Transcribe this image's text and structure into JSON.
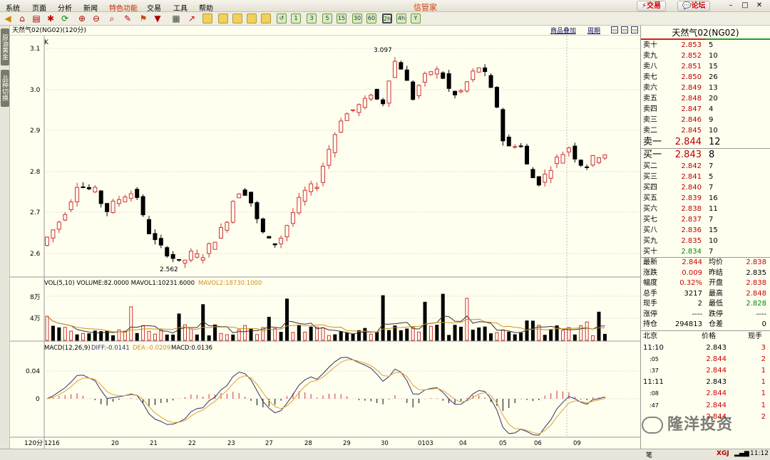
{
  "menu": {
    "items": [
      "系统",
      "页面",
      "分析",
      "新闻",
      "特色功能",
      "交易",
      "工具",
      "帮助"
    ],
    "title": "信管家",
    "trade_btn": "交易",
    "forum_btn": "论坛"
  },
  "toolbar": {
    "buttons": [
      "↺",
      "↻",
      "1",
      "3",
      "5",
      "15",
      "30",
      "60",
      "2h",
      "4h",
      "Y"
    ]
  },
  "left_tabs": [
    "原油黄金",
    "品种切换"
  ],
  "header": {
    "symbol": "天然气02(NG02)(120分)",
    "link_overlay": "商品叠加",
    "link_period": "周期"
  },
  "price_axis": {
    "ticks": [
      "3.1",
      "3.0",
      "2.9",
      "2.8",
      "2.7",
      "2.6"
    ],
    "k_label": "K",
    "high_label": "3.097",
    "low_label": "2.562"
  },
  "volume": {
    "legend": "VOL(5,10) VOLUME:82.0000 MAVOL1:10231.6000",
    "mavol2": "MAVOL2:18730.1000",
    "ticks": [
      "8万",
      "4万"
    ]
  },
  "macd": {
    "legend": "MACD(12,26,9)",
    "diff": "DIFF:-0.0141",
    "dea": "DEA:-0.0209",
    "macd": "MACD:0.0136",
    "ticks": [
      "0.04",
      "0"
    ]
  },
  "xaxis": {
    "period": "120分",
    "labels": [
      "1216",
      "20",
      "21",
      "22",
      "23",
      "27",
      "28",
      "29",
      "30",
      "0103",
      "04",
      "05",
      "06",
      "09"
    ]
  },
  "colors": {
    "up": "#d03030",
    "down": "#000000",
    "mavol1": "#333333",
    "mavol2": "#d09020",
    "diff": "#333366",
    "dea": "#e0a030"
  },
  "right_panel": {
    "title": "天然气02(NG02)",
    "asks": [
      {
        "l": "卖十",
        "p": "2.853",
        "v": "5"
      },
      {
        "l": "卖九",
        "p": "2.852",
        "v": "10"
      },
      {
        "l": "卖八",
        "p": "2.851",
        "v": "15"
      },
      {
        "l": "卖七",
        "p": "2.850",
        "v": "26"
      },
      {
        "l": "卖六",
        "p": "2.849",
        "v": "13"
      },
      {
        "l": "卖五",
        "p": "2.848",
        "v": "20"
      },
      {
        "l": "卖四",
        "p": "2.847",
        "v": "4"
      },
      {
        "l": "卖三",
        "p": "2.846",
        "v": "9"
      },
      {
        "l": "卖二",
        "p": "2.845",
        "v": "10"
      },
      {
        "l": "卖一",
        "p": "2.844",
        "v": "12"
      }
    ],
    "bids": [
      {
        "l": "买一",
        "p": "2.843",
        "v": "8"
      },
      {
        "l": "买二",
        "p": "2.842",
        "v": "7"
      },
      {
        "l": "买三",
        "p": "2.841",
        "v": "5"
      },
      {
        "l": "买四",
        "p": "2.840",
        "v": "7"
      },
      {
        "l": "买五",
        "p": "2.839",
        "v": "16"
      },
      {
        "l": "买六",
        "p": "2.838",
        "v": "11"
      },
      {
        "l": "买七",
        "p": "2.837",
        "v": "7"
      },
      {
        "l": "买八",
        "p": "2.836",
        "v": "15"
      },
      {
        "l": "买九",
        "p": "2.835",
        "v": "10"
      },
      {
        "l": "买十",
        "p": "2.834",
        "v": "7"
      }
    ],
    "stats": [
      {
        "l1": "最新",
        "v1": "2.844",
        "l2": "均价",
        "v2": "2.838"
      },
      {
        "l1": "涨跌",
        "v1": "0.009",
        "l2": "昨结",
        "v2": "2.835"
      },
      {
        "l1": "幅度",
        "v1": "0.32%",
        "l2": "开盘",
        "v2": "2.838"
      },
      {
        "l1": "总手",
        "v1": "3217",
        "l2": "最高",
        "v2": "2.848"
      },
      {
        "l1": "现手",
        "v1": "2",
        "l2": "最低",
        "v2": "2.828"
      },
      {
        "l1": "涨停",
        "v1": "----",
        "l2": "跌停",
        "v2": "----"
      },
      {
        "l1": "持仓",
        "v1": "294813",
        "l2": "仓差",
        "v2": "0"
      }
    ],
    "ticks_header": {
      "c1": "北京",
      "c2": "价格",
      "c3": "现手"
    },
    "ticks": [
      {
        "t": "11:10",
        "p": "2.843",
        "v": "3"
      },
      {
        "t": ":05",
        "p": "2.844",
        "v": "2"
      },
      {
        "t": ":37",
        "p": "2.844",
        "v": "1"
      },
      {
        "t": "11:11",
        "p": "2.843",
        "v": "1"
      },
      {
        "t": ":08",
        "p": "2.844",
        "v": "1"
      },
      {
        "t": ":47",
        "p": "2.844",
        "v": "1"
      },
      {
        "t": "",
        "p": "2.844",
        "v": "2"
      }
    ]
  },
  "status": {
    "label": "笔",
    "right": "XGJ",
    "time": "11:12"
  },
  "watermark": "隆洋投资"
}
